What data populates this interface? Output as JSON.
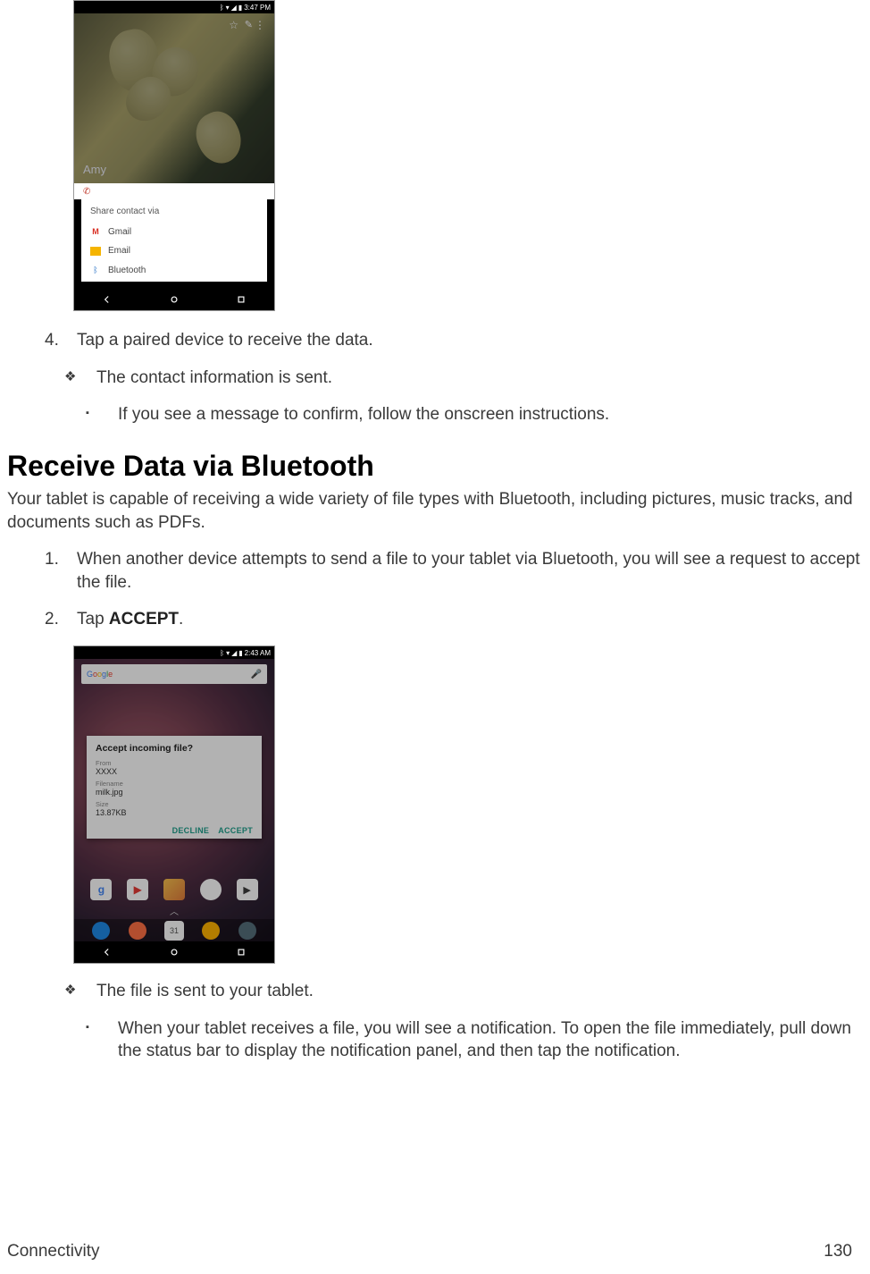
{
  "screenshot1": {
    "statusbar_time": "3:47 PM",
    "contact_name": "Amy",
    "sheet_title": "Share contact via",
    "options": {
      "gmail": "Gmail",
      "email": "Email",
      "bluetooth": "Bluetooth"
    }
  },
  "step4": {
    "num": "4.",
    "text": "Tap a paired device to receive the data."
  },
  "step4_sub1": "The contact information is sent.",
  "step4_sub1_a": "If you see a message to confirm, follow the onscreen instructions.",
  "heading1": "Receive Data via Bluetooth",
  "para1": "Your tablet is capable of receiving a wide variety of file types with Bluetooth, including pictures, music tracks, and documents such as PDFs.",
  "recv_step1": {
    "num": "1.",
    "text": "When another device attempts to send a file to your tablet via Bluetooth, you will see a request to accept the file."
  },
  "recv_step2": {
    "num": "2.",
    "text_a": "Tap ",
    "text_b": "ACCEPT",
    "text_c": "."
  },
  "screenshot2": {
    "statusbar_time": "2:43 AM",
    "search_placeholder": "Google",
    "dialog_title": "Accept incoming file?",
    "from_label": "From",
    "from_value": "XXXX",
    "filename_label": "Filename",
    "filename_value": "milk.jpg",
    "size_label": "Size",
    "size_value": "13.87KB",
    "decline": "DECLINE",
    "accept": "ACCEPT"
  },
  "recv_sub1": "The file is sent to your tablet.",
  "recv_sub1_a": "When your tablet receives a file, you will see a notification. To open the file immediately, pull down the status bar to display the notification panel, and then tap the notification.",
  "footer": {
    "section": "Connectivity",
    "page": "130"
  }
}
